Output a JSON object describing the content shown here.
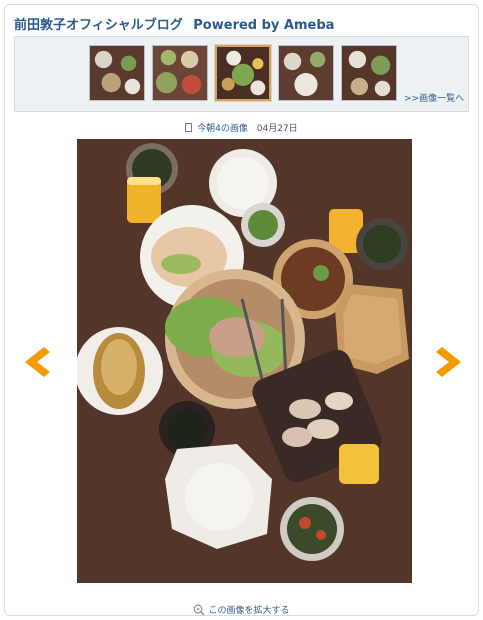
{
  "header": {
    "blog_title": "前田敦子オフィシャルブログ",
    "powered_by": "Powered by Ameba"
  },
  "thumbnails": {
    "count": 5,
    "selected_index": 2,
    "view_all_label": ">>画像一覧へ"
  },
  "photo": {
    "title": "今朝4の画像",
    "date": "04月27日"
  },
  "nav": {
    "prev_icon": "chevron-left-icon",
    "next_icon": "chevron-right-icon",
    "accent_color": "#f29c00"
  },
  "footer": {
    "enlarge_label": "この画像を拡大する"
  },
  "colors": {
    "link": "#2b5a8c",
    "table": "#4a2e24",
    "strip_bg": "#eef1f4"
  }
}
